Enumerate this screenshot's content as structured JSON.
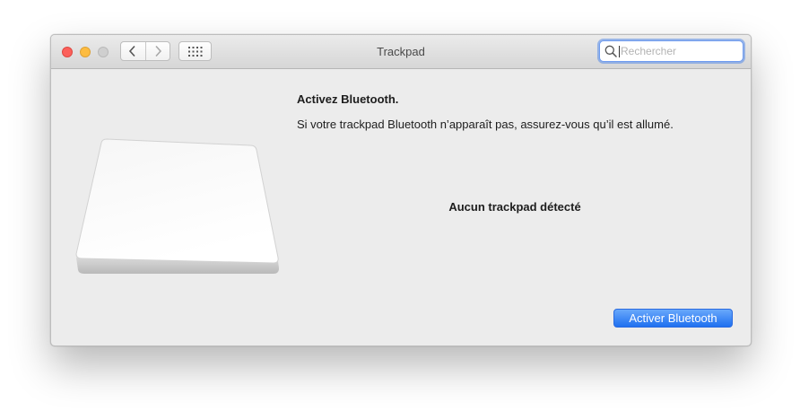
{
  "window": {
    "title": "Trackpad",
    "traffic_lights": {
      "close_color": "#fc605b",
      "minimize_color": "#fdbc40",
      "zoom_color": "#cfcfcf"
    }
  },
  "toolbar": {
    "back_icon": "chevron-left-icon",
    "forward_icon": "chevron-right-icon",
    "show_all_icon": "grid-icon"
  },
  "search": {
    "placeholder": "Rechercher",
    "value": "",
    "icon": "search-icon"
  },
  "main": {
    "heading": "Activez Bluetooth.",
    "description": "Si votre trackpad Bluetooth n’apparaît pas, assurez-vous qu’il est allumé.",
    "status": "Aucun trackpad détecté",
    "button_label": "Activer Bluetooth",
    "accent_color": "#1f70f0"
  }
}
